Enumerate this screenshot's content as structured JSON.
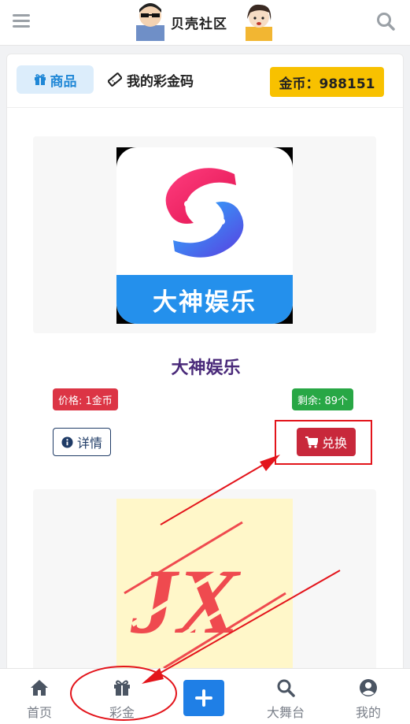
{
  "header": {
    "logo_text": "贝壳社区",
    "icons": {
      "left": "menu-icon",
      "right": "search-icon"
    }
  },
  "tabs": {
    "goods_label": "商品",
    "my_code_label": "我的彩金码",
    "goods_icon": "gift-icon",
    "code_icon": "ticket-icon"
  },
  "coins": {
    "label": "金币：988151"
  },
  "products": [
    {
      "image_text": "大神娱乐",
      "title": "大神娱乐",
      "price": "价格: 1金币",
      "stock": "剩余: 89个",
      "detail_label": "详情",
      "exchange_label": "兑换"
    },
    {
      "image_text": "JX"
    }
  ],
  "bottom_nav": {
    "items": [
      {
        "label": "首页",
        "icon": "home-icon"
      },
      {
        "label": "彩金",
        "icon": "gift-icon"
      },
      {
        "label": "",
        "icon": "plus-icon"
      },
      {
        "label": "大舞台",
        "icon": "search-icon"
      },
      {
        "label": "我的",
        "icon": "user-icon"
      }
    ]
  },
  "colors": {
    "accent_blue": "#1f7fe6",
    "coin_yellow": "#f8c100",
    "price_red": "#dc3545",
    "stock_green": "#28a745",
    "exchange_red": "#c8283b",
    "title_purple": "#4a2a7a",
    "annotation_red": "#e3141b"
  }
}
